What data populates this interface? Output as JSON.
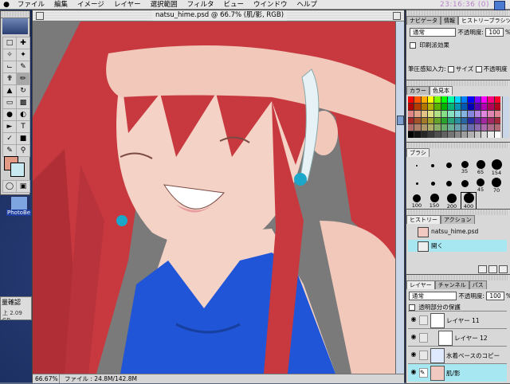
{
  "menubar": {
    "apple": "",
    "items": [
      "ファイル",
      "編集",
      "イメージ",
      "レイヤー",
      "選択範囲",
      "フィルタ",
      "ビュー",
      "ウインドウ",
      "ヘルプ"
    ],
    "clock": "23:16:36 (0)"
  },
  "desktop": {
    "icon_label": "PhotoBe",
    "finder_text_1": "量確認",
    "finder_text_2": "上 2.09 GB"
  },
  "document": {
    "title": "natsu_hime.psd @ 66.7% (肌/影, RGB)",
    "zoom": "66.67%",
    "file_info": "ファイル : 24.8M/142.8M"
  },
  "palettes": {
    "top": {
      "tabs": [
        "ナビゲータ",
        "情報",
        "ヒストリーブラシツールオプション"
      ],
      "mode": "通常",
      "opacity_label": "不透明度:",
      "opacity": "100",
      "unit": "%",
      "print_effect": "印刷派効果",
      "pressure_label": "筆圧感知入力:",
      "pressure_size": "サイズ",
      "pressure_opacity": "不透明度"
    },
    "color": {
      "tabs": [
        "カラー",
        "色見本"
      ]
    },
    "brushes": {
      "tab": "ブラシ",
      "sizes": [
        "35",
        "65",
        "154",
        "45",
        "70",
        "100",
        "150",
        "200",
        "400"
      ]
    },
    "history": {
      "tabs": [
        "ヒストリー",
        "アクション"
      ],
      "items": [
        "natsu_hime.psd",
        "開く"
      ]
    },
    "layers": {
      "tabs": [
        "レイヤー",
        "チャンネル",
        "パス"
      ],
      "mode": "通常",
      "opacity_label": "不透明度:",
      "opacity": "100",
      "unit": "%",
      "preserve": "透明部分の保護",
      "items": [
        "レイヤー 11",
        "レイヤー 12",
        "水着ベースのコピー",
        "肌/影"
      ]
    }
  },
  "colors": {
    "foreground": "#e39a85",
    "background": "#c7e9ef",
    "hair": "#c8393f",
    "skin": "#f4d2c6",
    "swimsuit": "#1f55d6",
    "layer_active": "#a6e7f2"
  }
}
